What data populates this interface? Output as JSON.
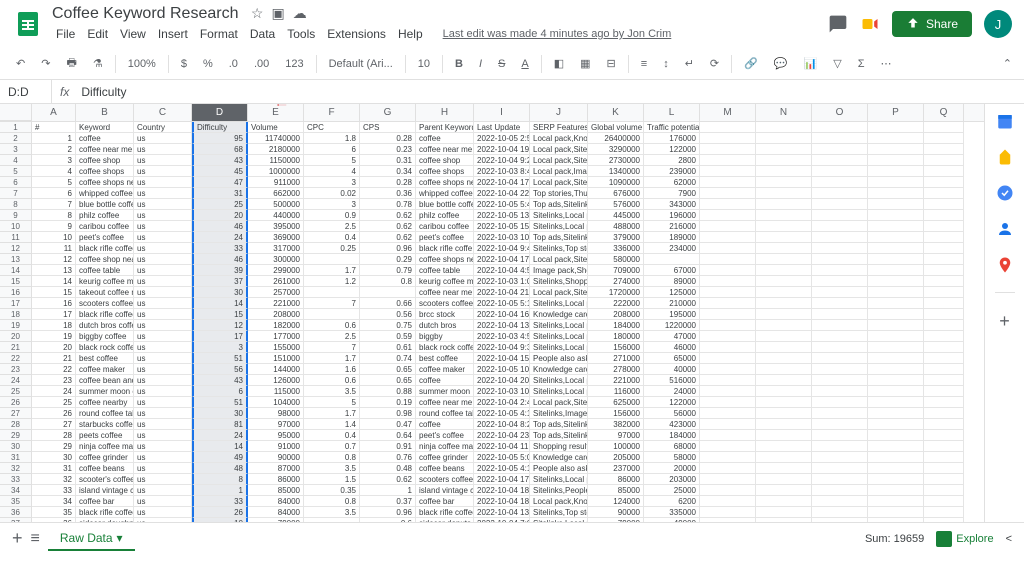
{
  "doc": {
    "title": "Coffee Keyword Research",
    "last_edit": "Last edit was made 4 minutes ago by Jon Crim",
    "avatar_letter": "J"
  },
  "menu": [
    "File",
    "Edit",
    "View",
    "Insert",
    "Format",
    "Data",
    "Tools",
    "Extensions",
    "Help"
  ],
  "toolbar": {
    "zoom": "100%",
    "currency": "$",
    "percent": "%",
    "dec1": ".0",
    "dec2": ".00",
    "num_format": "123",
    "font": "Default (Ari...",
    "font_size": "10"
  },
  "share_label": "Share",
  "formula": {
    "cell_ref": "D:D",
    "fx": "fx",
    "value": "Difficulty"
  },
  "columns": [
    "A",
    "B",
    "C",
    "D",
    "E",
    "F",
    "G",
    "H",
    "I",
    "J",
    "K",
    "L",
    "M",
    "N",
    "O",
    "P",
    "Q"
  ],
  "selected_col": "D",
  "headers": [
    "#",
    "Keyword",
    "Country",
    "Difficulty",
    "Volume",
    "CPC",
    "CPS",
    "Parent Keyword",
    "Last Update",
    "SERP Features",
    "Global volume",
    "Traffic potential"
  ],
  "rows": [
    [
      1,
      "coffee",
      "us",
      95,
      11740000,
      1.8,
      0.28,
      "coffee",
      "2022-10-05 2:52",
      "Local pack,Knov",
      26400000,
      176000
    ],
    [
      2,
      "coffee near me",
      "us",
      68,
      2180000,
      6,
      0.23,
      "coffee near me",
      "2022-10-04 19:2",
      "Local pack,Siteli",
      3290000,
      122000
    ],
    [
      3,
      "coffee shop",
      "us",
      43,
      1150000,
      5,
      0.31,
      "coffee shop",
      "2022-10-04 9:29",
      "Local pack,Siteli",
      2730000,
      2800
    ],
    [
      4,
      "coffee shops",
      "us",
      45,
      1000000,
      4,
      0.34,
      "coffee shops",
      "2022-10-03 8:45",
      "Local pack,Imag",
      1340000,
      239000
    ],
    [
      5,
      "coffee shops ne",
      "us",
      47,
      911000,
      3,
      0.28,
      "coffee shops ne",
      "2022-10-04 17:0",
      "Local pack,Siteli",
      1090000,
      62000
    ],
    [
      6,
      "whipped coffee",
      "us",
      31,
      662000,
      0.02,
      0.36,
      "whipped coffee",
      "2022-10-04 22:3",
      "Top stories,Thur",
      676000,
      7900
    ],
    [
      7,
      "blue bottle coffee",
      "us",
      25,
      500000,
      3,
      0.78,
      "blue bottle coffe",
      "2022-10-05 5:46",
      "Top ads,Sitelink",
      576000,
      343000
    ],
    [
      8,
      "philz coffee",
      "us",
      20,
      440000,
      0.9,
      0.62,
      "philz coffee",
      "2022-10-05 13:5",
      "Sitelinks,Local p",
      445000,
      196000
    ],
    [
      9,
      "caribou coffee",
      "us",
      46,
      395000,
      2.5,
      0.62,
      "caribou coffee",
      "2022-10-05 15:0",
      "Sitelinks,Local p",
      488000,
      216000
    ],
    [
      10,
      "peet's coffee",
      "us",
      24,
      369000,
      0.4,
      0.62,
      "peet's coffee",
      "2022-10-03 10:5",
      "Top ads,Sitelink",
      379000,
      189000
    ],
    [
      11,
      "black rifle coffee",
      "us",
      33,
      317000,
      0.25,
      0.96,
      "black rifle coffe",
      "2022-10-04 9:42",
      "Sitelinks,Top sto",
      336000,
      234000
    ],
    [
      12,
      "coffee shop nea",
      "us",
      46,
      300000,
      "",
      0.29,
      "coffee shops ne",
      "2022-10-04 17:2",
      "Local pack,Siteli",
      580000,
      ""
    ],
    [
      13,
      "coffee table",
      "us",
      39,
      299000,
      1.7,
      0.79,
      "coffee table",
      "2022-10-04 4:55",
      "Image pack,Sho",
      709000,
      67000
    ],
    [
      14,
      "keurig coffee ma",
      "us",
      37,
      261000,
      1.2,
      0.8,
      "keurig coffee ma",
      "2022-10-03 1:09",
      "Sitelinks,Shoppi",
      274000,
      89000
    ],
    [
      15,
      "takeout coffee n",
      "us",
      30,
      257000,
      "",
      "",
      "coffee near me",
      "2022-10-04 21:4",
      "Local pack,Siteli",
      1720000,
      125000
    ],
    [
      16,
      "scooters coffee",
      "us",
      14,
      221000,
      7,
      0.66,
      "scooters coffee",
      "2022-10-05 5:15",
      "Sitelinks,Local p",
      222000,
      210000
    ],
    [
      17,
      "black rifle coffee",
      "us",
      15,
      208000,
      "",
      0.56,
      "brcc stock",
      "2022-10-04 16:3",
      "Knowledge card",
      208000,
      195000
    ],
    [
      18,
      "dutch bros coffee",
      "us",
      12,
      182000,
      0.6,
      0.75,
      "dutch bros",
      "2022-10-04 13:5",
      "Sitelinks,Local p",
      184000,
      1220000
    ],
    [
      19,
      "biggby coffee",
      "us",
      17,
      177000,
      2.5,
      0.59,
      "biggby",
      "2022-10-03 4:50",
      "Sitelinks,Local p",
      180000,
      47000
    ],
    [
      20,
      "black rock coffee",
      "us",
      3,
      155000,
      7,
      0.61,
      "black rock coffe",
      "2022-10-04 9:37",
      "Sitelinks,Local p",
      156000,
      46000
    ],
    [
      21,
      "best coffee",
      "us",
      51,
      151000,
      1.7,
      0.74,
      "best coffee",
      "2022-10-04 15:4",
      "People also ask",
      271000,
      65000
    ],
    [
      22,
      "coffee maker",
      "us",
      56,
      144000,
      1.6,
      0.65,
      "coffee maker",
      "2022-10-05 10:1",
      "Knowledge card",
      278000,
      40000
    ],
    [
      23,
      "coffee bean and",
      "us",
      43,
      126000,
      0.6,
      0.65,
      "coffee",
      "2022-10-04 20:0",
      "Sitelinks,Local p",
      221000,
      516000
    ],
    [
      24,
      "summer moon c",
      "us",
      6,
      115000,
      3.5,
      0.88,
      "summer moon",
      "2022-10-03 10:4",
      "Sitelinks,Local p",
      116000,
      24000
    ],
    [
      25,
      "coffee nearby",
      "us",
      51,
      104000,
      5,
      0.19,
      "coffee near me",
      "2022-10-04 2:45",
      "Local pack,Siteli",
      625000,
      122000
    ],
    [
      26,
      "round coffee tab",
      "us",
      30,
      98000,
      1.7,
      0.98,
      "round coffee tab",
      "2022-10-05 4:13",
      "Sitelinks,Image p",
      156000,
      56000
    ],
    [
      27,
      "starbucks coffee",
      "us",
      81,
      97000,
      1.4,
      0.47,
      "coffee",
      "2022-10-04 8:27",
      "Top ads,Sitelink",
      382000,
      423000
    ],
    [
      28,
      "peets coffee",
      "us",
      24,
      95000,
      0.4,
      0.64,
      "peet's coffee",
      "2022-10-04 23:3",
      "Top ads,Sitelink",
      97000,
      184000
    ],
    [
      29,
      "ninja coffee mak",
      "us",
      14,
      91000,
      0.7,
      0.91,
      "ninja coffee mak",
      "2022-10-04 11:0",
      "Shopping results",
      100000,
      68000
    ],
    [
      30,
      "coffee grinder",
      "us",
      49,
      90000,
      0.8,
      0.76,
      "coffee grinder",
      "2022-10-05 5:02",
      "Knowledge card",
      205000,
      58000
    ],
    [
      31,
      "coffee beans",
      "us",
      48,
      87000,
      3.5,
      0.48,
      "coffee beans",
      "2022-10-05 4:15",
      "People also ask",
      237000,
      20000
    ],
    [
      32,
      "scooter's coffee",
      "us",
      8,
      86000,
      1.5,
      0.62,
      "scooters coffee",
      "2022-10-04 17:2",
      "Sitelinks,Local p",
      86000,
      203000
    ],
    [
      33,
      "island vintage c",
      "us",
      1,
      85000,
      0.35,
      1,
      "island vintage co",
      "2022-10-04 18:4",
      "Sitelinks,People",
      85000,
      25000
    ],
    [
      34,
      "coffee bar",
      "us",
      33,
      84000,
      0.8,
      0.37,
      "coffee bar",
      "2022-10-04 18:2",
      "Local pack,Knov",
      124000,
      6200
    ],
    [
      35,
      "black rifle coffee",
      "us",
      26,
      84000,
      3.5,
      0.96,
      "black rifle coffee",
      "2022-10-04 13:1",
      "Sitelinks,Top sto",
      90000,
      335000
    ],
    [
      36,
      "sidecar doughnu",
      "us",
      10,
      79000,
      "",
      0.6,
      "sidecar donuts",
      "2022-10-04 7:01",
      "Sitelinks,Local p",
      79000,
      49000
    ]
  ],
  "tabs": {
    "sheet_name": "Raw Data",
    "sum": "Sum: 19659",
    "explore": "Explore"
  }
}
